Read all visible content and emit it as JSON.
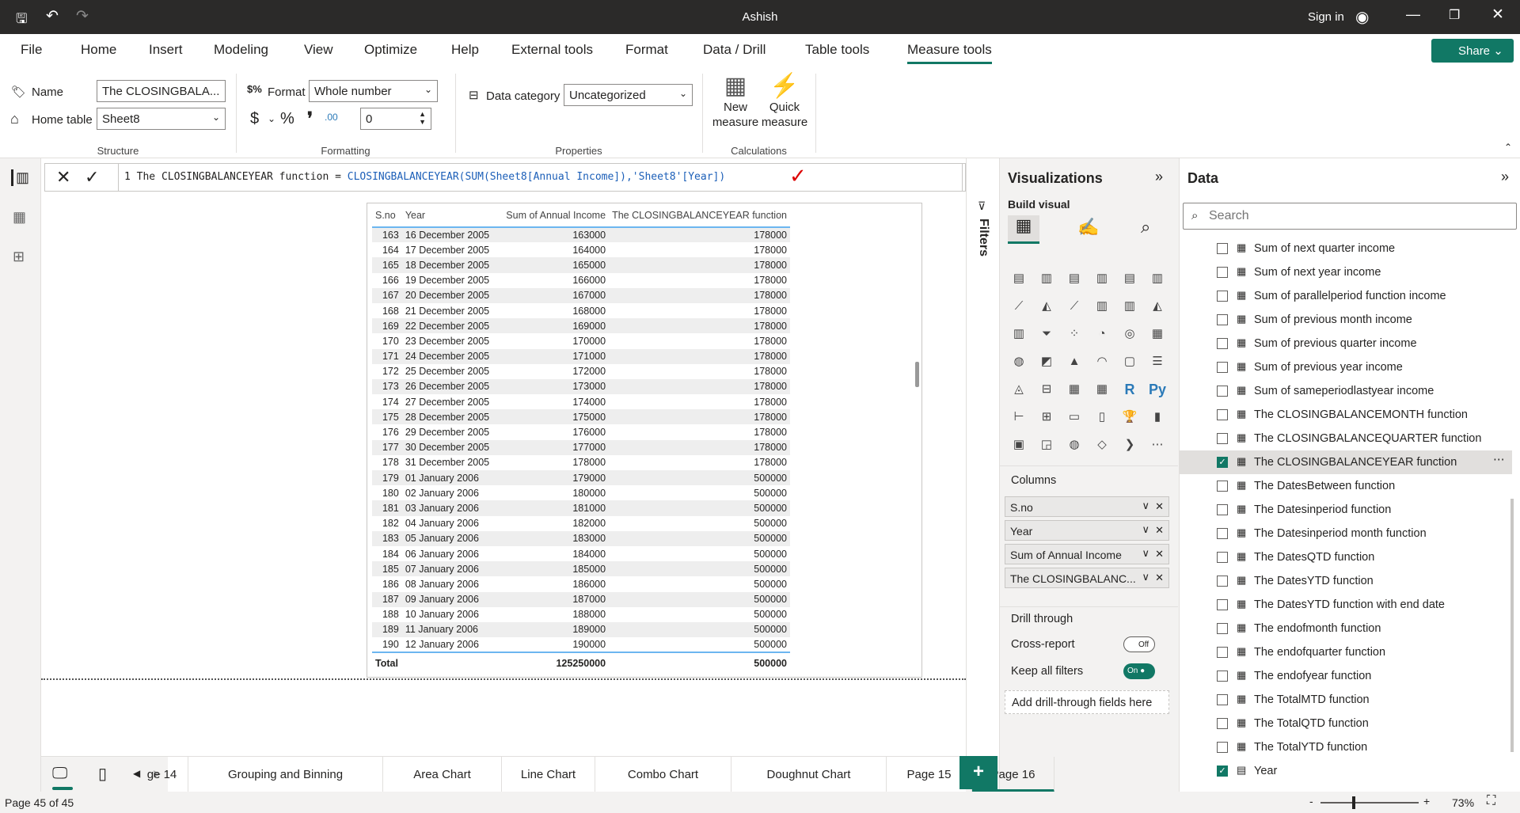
{
  "titlebar": {
    "title": "Ashish",
    "sign_in": "Sign in"
  },
  "menu": [
    "File",
    "Home",
    "Insert",
    "Modeling",
    "View",
    "Optimize",
    "Help",
    "External tools",
    "Format",
    "Data / Drill",
    "Table tools",
    "Measure tools"
  ],
  "share_label": "Share",
  "ribbon": {
    "name_label": "Name",
    "name_value": "The CLOSINGBALA...",
    "home_table_label": "Home table",
    "home_table_value": "Sheet8",
    "format_label": "Format",
    "format_value": "Whole number",
    "decimal_value": "0",
    "currency_symbol": "$",
    "percent_symbol": "%",
    "comma_symbol": "❜",
    "decimals_symbol": ".00",
    "data_category_label": "Data category",
    "data_category_value": "Uncategorized",
    "new_measure": "New measure",
    "quick_measure": "Quick measure",
    "groups": [
      "Structure",
      "Formatting",
      "Properties",
      "Calculations"
    ]
  },
  "formula": {
    "line": "1",
    "text_plain": " The CLOSINGBALANCEYEAR function = ",
    "text_fn": "CLOSINGBALANCEYEAR(SUM(Sheet8[Annual Income]),'Sheet8'[Year])"
  },
  "table": {
    "headers": [
      "S.no",
      "Year",
      "Sum of Annual Income",
      "The CLOSINGBALANCEYEAR function"
    ],
    "rows": [
      [
        "163",
        "16 December 2005",
        "163000",
        "178000"
      ],
      [
        "164",
        "17 December 2005",
        "164000",
        "178000"
      ],
      [
        "165",
        "18 December 2005",
        "165000",
        "178000"
      ],
      [
        "166",
        "19 December 2005",
        "166000",
        "178000"
      ],
      [
        "167",
        "20 December 2005",
        "167000",
        "178000"
      ],
      [
        "168",
        "21 December 2005",
        "168000",
        "178000"
      ],
      [
        "169",
        "22 December 2005",
        "169000",
        "178000"
      ],
      [
        "170",
        "23 December 2005",
        "170000",
        "178000"
      ],
      [
        "171",
        "24 December 2005",
        "171000",
        "178000"
      ],
      [
        "172",
        "25 December 2005",
        "172000",
        "178000"
      ],
      [
        "173",
        "26 December 2005",
        "173000",
        "178000"
      ],
      [
        "174",
        "27 December 2005",
        "174000",
        "178000"
      ],
      [
        "175",
        "28 December 2005",
        "175000",
        "178000"
      ],
      [
        "176",
        "29 December 2005",
        "176000",
        "178000"
      ],
      [
        "177",
        "30 December 2005",
        "177000",
        "178000"
      ],
      [
        "178",
        "31 December 2005",
        "178000",
        "178000"
      ],
      [
        "179",
        "01 January 2006",
        "179000",
        "500000"
      ],
      [
        "180",
        "02 January 2006",
        "180000",
        "500000"
      ],
      [
        "181",
        "03 January 2006",
        "181000",
        "500000"
      ],
      [
        "182",
        "04 January 2006",
        "182000",
        "500000"
      ],
      [
        "183",
        "05 January 2006",
        "183000",
        "500000"
      ],
      [
        "184",
        "06 January 2006",
        "184000",
        "500000"
      ],
      [
        "185",
        "07 January 2006",
        "185000",
        "500000"
      ],
      [
        "186",
        "08 January 2006",
        "186000",
        "500000"
      ],
      [
        "187",
        "09 January 2006",
        "187000",
        "500000"
      ],
      [
        "188",
        "10 January 2006",
        "188000",
        "500000"
      ],
      [
        "189",
        "11 January 2006",
        "189000",
        "500000"
      ],
      [
        "190",
        "12 January 2006",
        "190000",
        "500000"
      ]
    ],
    "total": [
      "Total",
      "",
      "125250000",
      "500000"
    ]
  },
  "filters_label": "Filters",
  "viz": {
    "title": "Visualizations",
    "build_visual": "Build visual",
    "columns_label": "Columns",
    "wells": [
      "S.no",
      "Year",
      "Sum of Annual Income",
      "The CLOSINGBALANC..."
    ],
    "drill_through": "Drill through",
    "cross_report": "Cross-report",
    "cross_report_state": "Off",
    "keep_filters": "Keep all filters",
    "keep_filters_state": "On",
    "add_drill": "Add drill-through fields here",
    "icons": [
      "▤",
      "▥",
      "▤",
      "▥",
      "▤",
      "▥",
      "⟋",
      "◭",
      "⟋",
      "▥",
      "▥",
      "◭",
      "▥",
      "⏷",
      "⁘",
      "◔",
      "◎",
      "▦",
      "◍",
      "◩",
      "▲",
      "◠",
      "▢",
      "☰",
      "◬",
      "⊟",
      "▦",
      "▦",
      "R",
      "Py",
      "⊢",
      "⊞",
      "▭",
      "▯",
      "🏆",
      "▮",
      "▣",
      "◲",
      "◍",
      "◇",
      "❯",
      "⋯"
    ]
  },
  "datapane": {
    "title": "Data",
    "search_placeholder": "Search",
    "items": [
      {
        "label": "Sum of next quarter income",
        "checked": false
      },
      {
        "label": "Sum of next year income",
        "checked": false
      },
      {
        "label": "Sum of parallelperiod function income",
        "checked": false
      },
      {
        "label": "Sum of previous month income",
        "checked": false
      },
      {
        "label": "Sum of previous quarter income",
        "checked": false
      },
      {
        "label": "Sum of previous year income",
        "checked": false
      },
      {
        "label": "Sum of sameperiodlastyear income",
        "checked": false
      },
      {
        "label": "The CLOSINGBALANCEMONTH function",
        "checked": false
      },
      {
        "label": "The CLOSINGBALANCEQUARTER function",
        "checked": false
      },
      {
        "label": "The CLOSINGBALANCEYEAR function",
        "checked": true
      },
      {
        "label": "The DatesBetween function",
        "checked": false
      },
      {
        "label": "The Datesinperiod function",
        "checked": false
      },
      {
        "label": "The Datesinperiod month function",
        "checked": false
      },
      {
        "label": "The DatesQTD function",
        "checked": false
      },
      {
        "label": "The DatesYTD function",
        "checked": false
      },
      {
        "label": "The DatesYTD function with end date",
        "checked": false
      },
      {
        "label": "The endofmonth function",
        "checked": false
      },
      {
        "label": "The endofquarter function",
        "checked": false
      },
      {
        "label": "The endofyear function",
        "checked": false
      },
      {
        "label": "The TotalMTD function",
        "checked": false
      },
      {
        "label": "The TotalQTD function",
        "checked": false
      },
      {
        "label": "The TotalYTD function",
        "checked": false
      },
      {
        "label": "Year",
        "checked": true
      }
    ]
  },
  "tabs": [
    "ge 14",
    "Grouping and Binning",
    "Area Chart",
    "Line Chart",
    "Combo Chart",
    "Doughnut Chart",
    "Page 15",
    "Page 16"
  ],
  "active_tab": "Page 16",
  "status": {
    "page": "Page 45 of 45",
    "zoom": "73%"
  },
  "colors": {
    "accent": "#117865",
    "titlebar": "#2b2a29"
  }
}
